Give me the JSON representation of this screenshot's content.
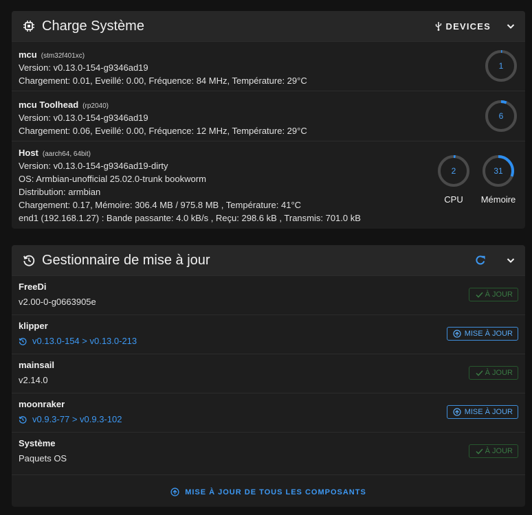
{
  "system_panel": {
    "title": "Charge Système",
    "devices_label": "DEVICES",
    "icons": {
      "title": "cpu-chip-icon",
      "devices": "usb-icon",
      "collapse": "chevron-down-icon"
    },
    "mcus": [
      {
        "name": "mcu",
        "chip": "(stm32f401xc)",
        "lines": [
          "Version: v0.13.0-154-g9346ad19",
          "Chargement: 0.01, Eveillé: 0.00, Fréquence: 84 MHz, Température: 29°C"
        ],
        "gauge": {
          "value": "1",
          "percent": 1
        }
      },
      {
        "name": "mcu Toolhead",
        "chip": "(rp2040)",
        "lines": [
          "Version: v0.13.0-154-g9346ad19",
          "Chargement: 0.06, Eveillé: 0.00, Fréquence: 12 MHz, Température: 29°C"
        ],
        "gauge": {
          "value": "6",
          "percent": 6
        }
      }
    ],
    "host": {
      "name": "Host",
      "chip": "(aarch64, 64bit)",
      "lines": [
        "Version: v0.13.0-154-g9346ad19-dirty",
        "OS: Armbian-unofficial 25.02.0-trunk bookworm",
        "Distribution: armbian",
        "Chargement: 0.17, Mémoire: 306.4 MB / 975.8 MB , Température: 41°C",
        "end1 (192.168.1.27) : Bande passante: 4.0 kB/s , Reçu: 298.6 kB , Transmis: 701.0 kB"
      ],
      "cpu": {
        "value": "2",
        "percent": 2,
        "label": "CPU"
      },
      "memory": {
        "value": "31",
        "percent": 31,
        "label": "Mémoire"
      }
    }
  },
  "update_panel": {
    "title": "Gestionnaire de mise à jour",
    "icons": {
      "title": "history-icon",
      "refresh": "refresh-icon",
      "collapse": "chevron-down-icon"
    },
    "items": [
      {
        "name": "FreeDi",
        "version": "v2.00-0-g0663905e",
        "status": "ok",
        "button": "À JOUR"
      },
      {
        "name": "klipper",
        "version": "v0.13.0-154 > v0.13.0-213",
        "status": "update",
        "button": "MISE À JOUR"
      },
      {
        "name": "mainsail",
        "version": "v2.14.0",
        "status": "ok",
        "button": "À JOUR"
      },
      {
        "name": "moonraker",
        "version": "v0.9.3-77 > v0.9.3-102",
        "status": "update",
        "button": "MISE À JOUR"
      },
      {
        "name": "Système",
        "version": "Paquets OS",
        "status": "ok",
        "button": "À JOUR"
      }
    ],
    "update_all_label": "MISE À JOUR DE TOUS LES COMPOSANTS"
  },
  "colors": {
    "accent": "#3d98f2",
    "ok_green": "#3a7a44",
    "background": "#121212",
    "panel": "#1e1e1e",
    "header": "#272727"
  }
}
